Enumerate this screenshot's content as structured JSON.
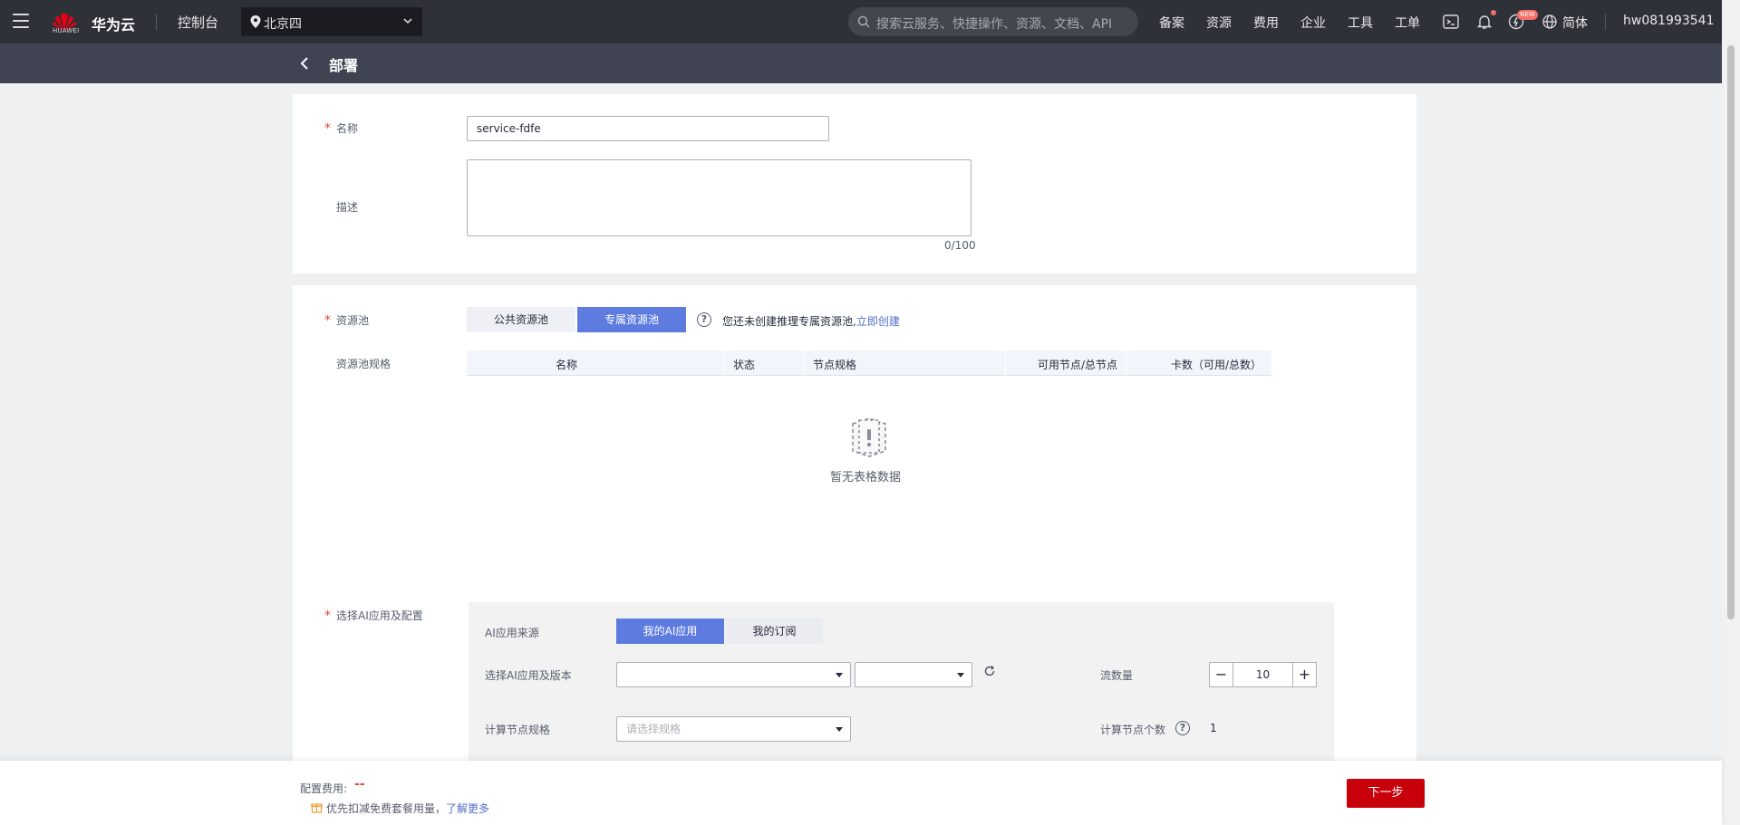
{
  "topbar": {
    "brand": "华为云",
    "logo_sub": "HUAWEI",
    "console": "控制台",
    "region": "北京四",
    "search_placeholder": "搜索云服务、快捷操作、资源、文档、API",
    "links": [
      "备案",
      "资源",
      "费用",
      "企业",
      "工具",
      "工单"
    ],
    "new_badge": "NEW",
    "lang": "简体",
    "user": "hw081993541"
  },
  "page": {
    "title": "部署"
  },
  "basic": {
    "name_label": "名称",
    "name_value": "service-fdfe",
    "desc_label": "描述",
    "desc_counter": "0/100"
  },
  "pool": {
    "label": "资源池",
    "tabs": [
      "公共资源池",
      "专属资源池"
    ],
    "active_tab": 1,
    "hint": "您还未创建推理专属资源池,",
    "hint_link": "立即创建",
    "spec_label": "资源池规格",
    "columns": [
      "名称",
      "状态",
      "节点规格",
      "可用节点/总节点",
      "卡数（可用/总数）"
    ],
    "empty_text": "暂无表格数据"
  },
  "ai": {
    "label": "选择AI应用及配置",
    "source_label": "AI应用来源",
    "source_tabs": [
      "我的AI应用",
      "我的订阅"
    ],
    "active_source": 0,
    "version_label": "选择AI应用及版本",
    "traffic_label": "流数量",
    "traffic_value": "10",
    "node_spec_label": "计算节点规格",
    "node_spec_placeholder": "请选择规格",
    "node_count_label": "计算节点个数",
    "node_count_value": "1"
  },
  "footer": {
    "fee_label": "配置费用:",
    "fee_value": "--",
    "promo_text": "优先扣减免费套餐用量，",
    "promo_link": "了解更多",
    "next_label": "下一步"
  },
  "colors": {
    "primary": "#5e7ce0",
    "next": "#c7000b",
    "topbar": "#2e3138",
    "required": "#e4463a"
  }
}
